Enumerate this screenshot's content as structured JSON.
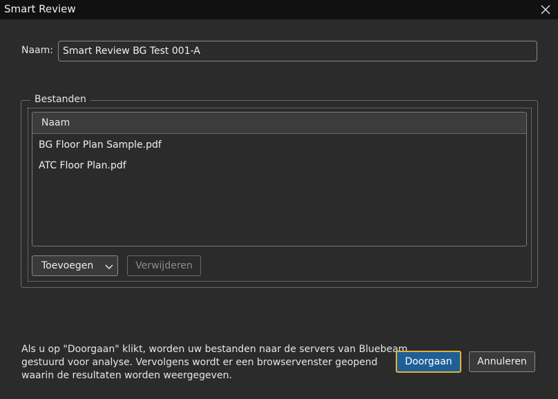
{
  "window": {
    "title": "Smart Review"
  },
  "name_field": {
    "label": "Naam:",
    "value": "Smart Review BG Test 001-A"
  },
  "files_group": {
    "legend": "Bestanden",
    "column_header": "Naam",
    "files": [
      "BG Floor Plan Sample.pdf",
      "ATC Floor Plan.pdf"
    ],
    "add_label": "Toevoegen",
    "remove_label": "Verwijderen"
  },
  "info": {
    "lines": [
      "Als u op \"Doorgaan\" klikt, worden uw bestanden naar de servers van Bluebeam",
      "gestuurd voor analyse. Vervolgens wordt er een browservenster geopend",
      "waarin de resultaten worden weergegeven."
    ]
  },
  "actions": {
    "continue_label": "Doorgaan",
    "cancel_label": "Annuleren"
  },
  "icons": {
    "close": "close-icon",
    "dropdown": "chevron-down-icon"
  },
  "colors": {
    "accent": "#1f5f96",
    "focus_ring": "#e0b43a"
  }
}
